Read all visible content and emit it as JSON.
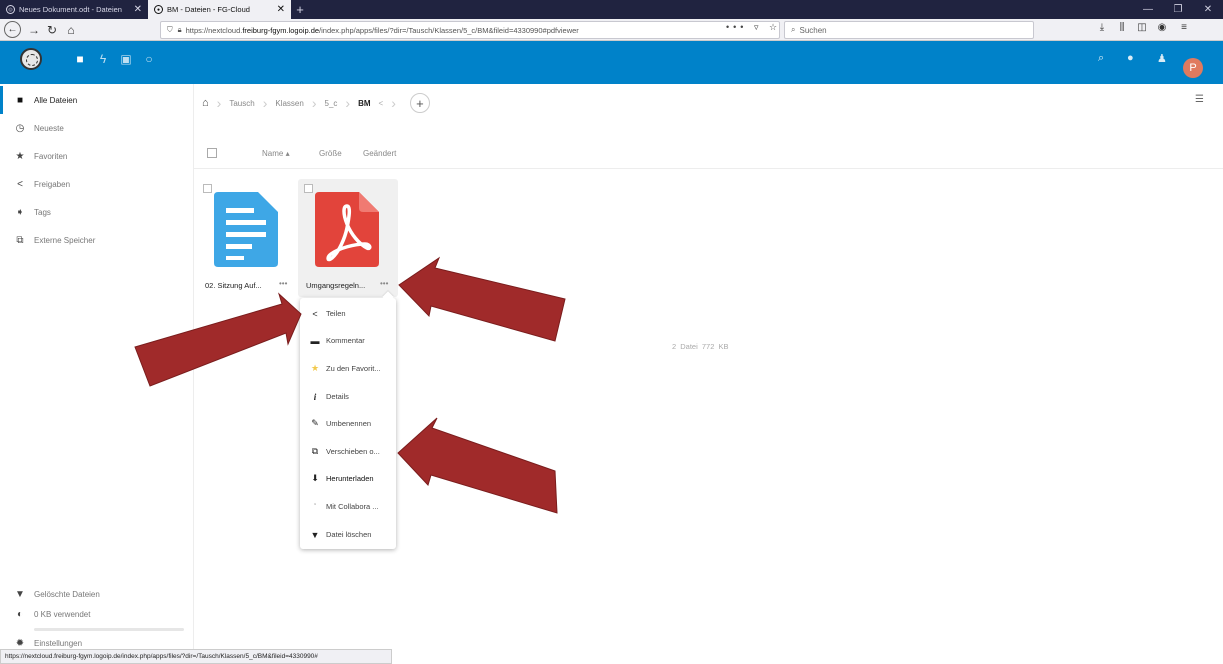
{
  "browser": {
    "tabs": [
      {
        "title": "Neues Dokument.odt - Dateien"
      },
      {
        "title": "BM - Dateien - FG-Cloud"
      }
    ],
    "url_prefix": "https://nextcloud.",
    "url_host": "freiburg-fgym.logoip.de",
    "url_path": "/index.php/apps/files/?dir=/Tausch/Klassen/5_c/BM&fileid=4330990#pdfviewer",
    "url_actions": "••• ▿ ☆",
    "search_placeholder": "Suchen",
    "status_url": "https://nextcloud.freiburg-fgym.logoip.de/index.php/apps/files/?dir=/Tausch/Klassen/5_c/BM&fileid=4330990#"
  },
  "sidebar": {
    "items": [
      {
        "label": "Alle Dateien",
        "icon": "folder-icon"
      },
      {
        "label": "Neueste",
        "icon": "clock-icon"
      },
      {
        "label": "Favoriten",
        "icon": "star-icon"
      },
      {
        "label": "Freigaben",
        "icon": "share-icon"
      },
      {
        "label": "Tags",
        "icon": "tag-icon"
      },
      {
        "label": "Externe Speicher",
        "icon": "external-icon"
      }
    ],
    "deleted": "Gelöschte Dateien",
    "quota": "0 KB verwendet",
    "settings": "Einstellungen"
  },
  "breadcrumb": [
    "Tausch",
    "Klassen",
    "5_c",
    "BM"
  ],
  "columns": {
    "name": "Name",
    "size": "Größe",
    "modified": "Geändert",
    "sort_indicator": "▴"
  },
  "files": [
    {
      "name": "02. Sitzung Auf...",
      "type": "document",
      "more": "•••"
    },
    {
      "name": "Umgangsregeln...",
      "type": "pdf",
      "more": "•••"
    }
  ],
  "summary": {
    "count": "2 Datei",
    "size": "772 KB"
  },
  "menu": [
    {
      "label": "Teilen",
      "icon": "share-icon"
    },
    {
      "label": "Kommentar",
      "icon": "comment-icon"
    },
    {
      "label": "Zu den Favorit...",
      "icon": "star-icon"
    },
    {
      "label": "Details",
      "icon": "info-icon"
    },
    {
      "label": "Umbenennen",
      "icon": "pencil-icon"
    },
    {
      "label": "Verschieben o...",
      "icon": "move-icon"
    },
    {
      "label": "Herunterladen",
      "icon": "download-icon"
    },
    {
      "label": "Mit Collabora ...",
      "icon": "collabora-icon"
    },
    {
      "label": "Datei löschen",
      "icon": "trash-icon"
    }
  ],
  "colors": {
    "brand": "#0082c9",
    "arrow": "#a02a2a",
    "pdf": "#e2443b",
    "doc": "#3ea7e6"
  }
}
